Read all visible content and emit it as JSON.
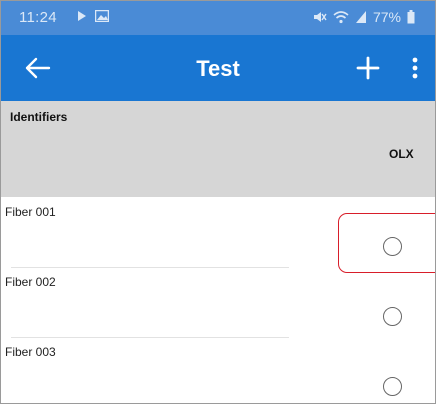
{
  "status_bar": {
    "time": "11:24",
    "battery": "77%",
    "icons": [
      "play-icon",
      "image-icon",
      "mute-icon",
      "wifi-icon",
      "signal-icon",
      "battery-icon"
    ]
  },
  "app_bar": {
    "title": "Test",
    "icons": [
      "back-arrow-icon",
      "plus-icon",
      "more-vert-icon"
    ]
  },
  "table": {
    "header_label": "Identifiers",
    "column_label": "OLX",
    "rows": [
      {
        "label": "Fiber 001",
        "selected": false
      },
      {
        "label": "Fiber 002",
        "selected": false
      },
      {
        "label": "Fiber 003",
        "selected": false
      }
    ]
  },
  "colors": {
    "status_bar": "#4a8bd6",
    "app_bar": "#1976d2",
    "header_bg": "#d6d6d6",
    "highlight": "#d81e2a"
  }
}
